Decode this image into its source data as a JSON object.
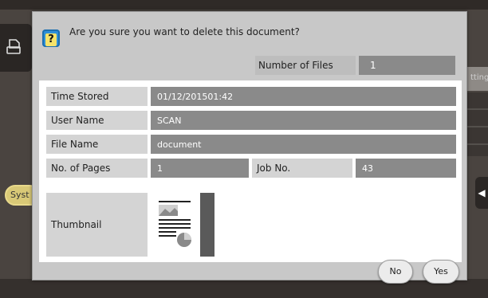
{
  "dialog": {
    "question": "Are you sure you want to delete this document?",
    "question_icon": "question-icon",
    "number_of_files": {
      "label": "Number of Files",
      "value": "1"
    }
  },
  "details": {
    "time_stored": {
      "label": "Time Stored",
      "value": "01/12/201501:42"
    },
    "user_name": {
      "label": "User Name",
      "value": "SCAN"
    },
    "file_name": {
      "label": "File Name",
      "value": "document"
    },
    "no_of_pages": {
      "label": "No. of Pages",
      "value": "1"
    },
    "job_no": {
      "label": "Job No.",
      "value": "43"
    },
    "thumbnail": {
      "label": "Thumbnail"
    }
  },
  "buttons": {
    "no": "No",
    "yes": "Yes"
  },
  "background": {
    "left_button_text": "Syst",
    "right_panel_text": "tting"
  },
  "colors": {
    "dialog_bg": "#c8c8c8",
    "value_bg": "#8a8a8a",
    "label_bg": "#d4d4d4",
    "icon_blue": "#2e8fd8",
    "icon_yellow": "#f6e36a"
  }
}
